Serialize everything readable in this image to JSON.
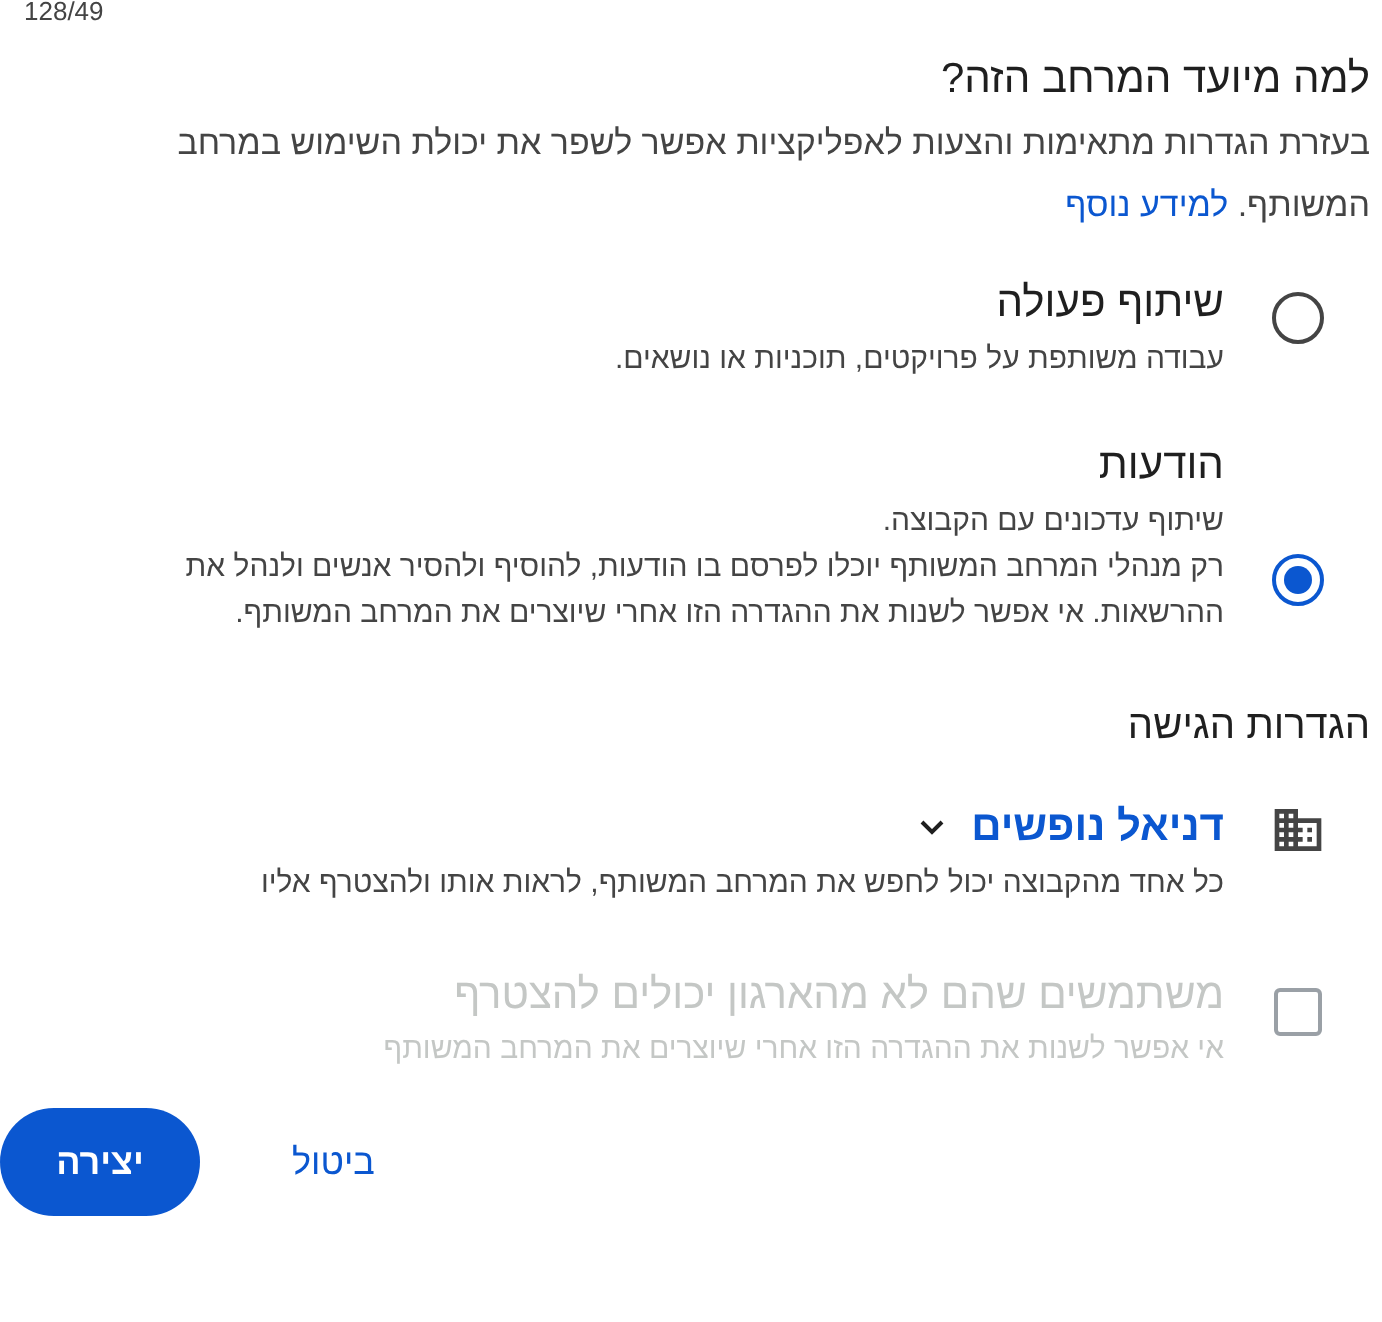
{
  "counter": "128/49",
  "purpose": {
    "heading": "למה מיועד המרחב הזה?",
    "text": "בעזרת הגדרות מתאימות והצעות לאפליקציות אפשר לשפר את יכולת השימוש במרחב המשותף.",
    "link": "למידע נוסף"
  },
  "space_types": [
    {
      "title": "שיתוף פעולה",
      "lines": [
        "עבודה משותפת על פרויקטים, תוכניות או נושאים."
      ],
      "selected": false
    },
    {
      "title": "הודעות",
      "lines": [
        "שיתוף עדכונים עם הקבוצה.",
        "רק מנהלי המרחב המשותף יוכלו לפרסם בו הודעות, להוסיף ולהסיר אנשים ולנהל את ההרשאות. אי אפשר לשנות את ההגדרה הזו אחרי שיוצרים את המרחב המשותף."
      ],
      "selected": true
    }
  ],
  "access": {
    "heading": "הגדרות הגישה",
    "audience": "דניאל נופשים",
    "audience_text": "כל אחד מהקבוצה יכול לחפש את המרחב המשותף, לראות אותו ולהצטרף אליו",
    "external": {
      "label": "משתמשים שהם לא מהארגון יכולים להצטרף",
      "hint": "אי אפשר לשנות את ההגדרה הזו אחרי שיוצרים את המרחב המשותף",
      "checked": false,
      "disabled": true
    }
  },
  "buttons": {
    "cancel": "ביטול",
    "create": "יצירה"
  }
}
